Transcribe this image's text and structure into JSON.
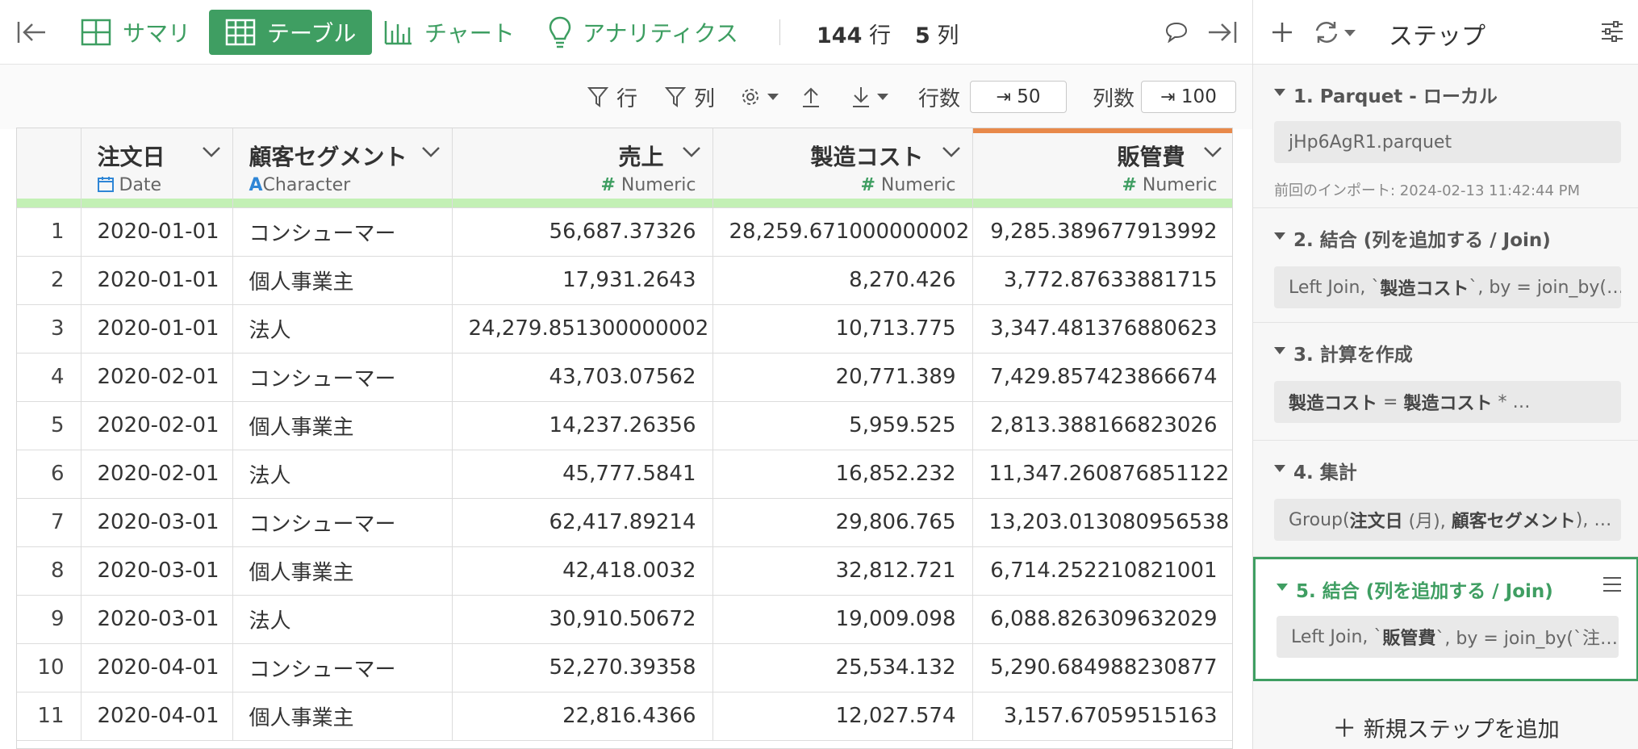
{
  "toolbar": {
    "tabs": [
      {
        "label": "サマリ",
        "icon": "summary-grid-icon"
      },
      {
        "label": "テーブル",
        "icon": "table-icon",
        "active": true
      },
      {
        "label": "チャート",
        "icon": "bar-chart-icon"
      },
      {
        "label": "アナリティクス",
        "icon": "lightbulb-icon"
      }
    ],
    "rows_count": "144",
    "rows_unit": "行",
    "cols_count": "5",
    "cols_unit": "列"
  },
  "subbar": {
    "filter_rows_label": "行",
    "filter_cols_label": "列",
    "rows_label": "行数",
    "rows_value": "50",
    "cols_label": "列数",
    "cols_value": "100"
  },
  "table": {
    "columns": [
      {
        "name": "注文日",
        "type": "Date",
        "type_icon": "calendar-icon"
      },
      {
        "name": "顧客セグメント",
        "type": "Character",
        "type_icon": "A"
      },
      {
        "name": "売上",
        "type": "Numeric",
        "type_icon": "#"
      },
      {
        "name": "製造コスト",
        "type": "Numeric",
        "type_icon": "#"
      },
      {
        "name": "販管費",
        "type": "Numeric",
        "type_icon": "#"
      }
    ],
    "rows": [
      [
        "1",
        "2020-01-01",
        "コンシューマー",
        "56,687.37326",
        "28,259.671000000002",
        "9,285.389677913992"
      ],
      [
        "2",
        "2020-01-01",
        "個人事業主",
        "17,931.2643",
        "8,270.426",
        "3,772.87633881715"
      ],
      [
        "3",
        "2020-01-01",
        "法人",
        "24,279.851300000002",
        "10,713.775",
        "3,347.481376880623"
      ],
      [
        "4",
        "2020-02-01",
        "コンシューマー",
        "43,703.07562",
        "20,771.389",
        "7,429.857423866674"
      ],
      [
        "5",
        "2020-02-01",
        "個人事業主",
        "14,237.26356",
        "5,959.525",
        "2,813.388166823026"
      ],
      [
        "6",
        "2020-02-01",
        "法人",
        "45,777.5841",
        "16,852.232",
        "11,347.260876851122"
      ],
      [
        "7",
        "2020-03-01",
        "コンシューマー",
        "62,417.89214",
        "29,806.765",
        "13,203.013080956538"
      ],
      [
        "8",
        "2020-03-01",
        "個人事業主",
        "42,418.0032",
        "32,812.721",
        "6,714.252210821001"
      ],
      [
        "9",
        "2020-03-01",
        "法人",
        "30,910.50672",
        "19,009.098",
        "6,088.826309632029"
      ],
      [
        "10",
        "2020-04-01",
        "コンシューマー",
        "52,270.39358",
        "25,534.132",
        "5,290.684988230877"
      ],
      [
        "11",
        "2020-04-01",
        "個人事業主",
        "22,816.4366",
        "12,027.574",
        "3,157.67059515163"
      ]
    ]
  },
  "side": {
    "title": "ステップ",
    "steps": [
      {
        "title": "1. Parquet - ローカル",
        "body": "jHp6AgR1.parquet",
        "note": "前回のインポート: 2024-02-13 11:42:44 PM"
      },
      {
        "title": "2. 結合 (列を追加する / Join)",
        "body_pre": "Left Join, `",
        "body_bold": "製造コスト",
        "body_post": "`, by = join_by(…"
      },
      {
        "title": "3. 計算を作成",
        "body_bold": "製造コスト",
        "body_post": " = ",
        "body_bold2": "製造コスト",
        "body_post2": " * …"
      },
      {
        "title": "4. 集計",
        "body_pre": "Group(",
        "body_bold": "注文日",
        "body_post": " (月), ",
        "body_bold2": "顧客セグメント",
        "body_post2": "), …"
      },
      {
        "title": "5. 結合 (列を追加する / Join)",
        "body_pre": "Left Join, `",
        "body_bold": "販管費",
        "body_post": "`, by = join_by(`注…",
        "active": true
      }
    ],
    "add_step_label": "新規ステップを追加"
  },
  "colors": {
    "accent": "#3f9e62",
    "header_bar": "#c3f0b5",
    "selected_col": "#e8894a"
  }
}
